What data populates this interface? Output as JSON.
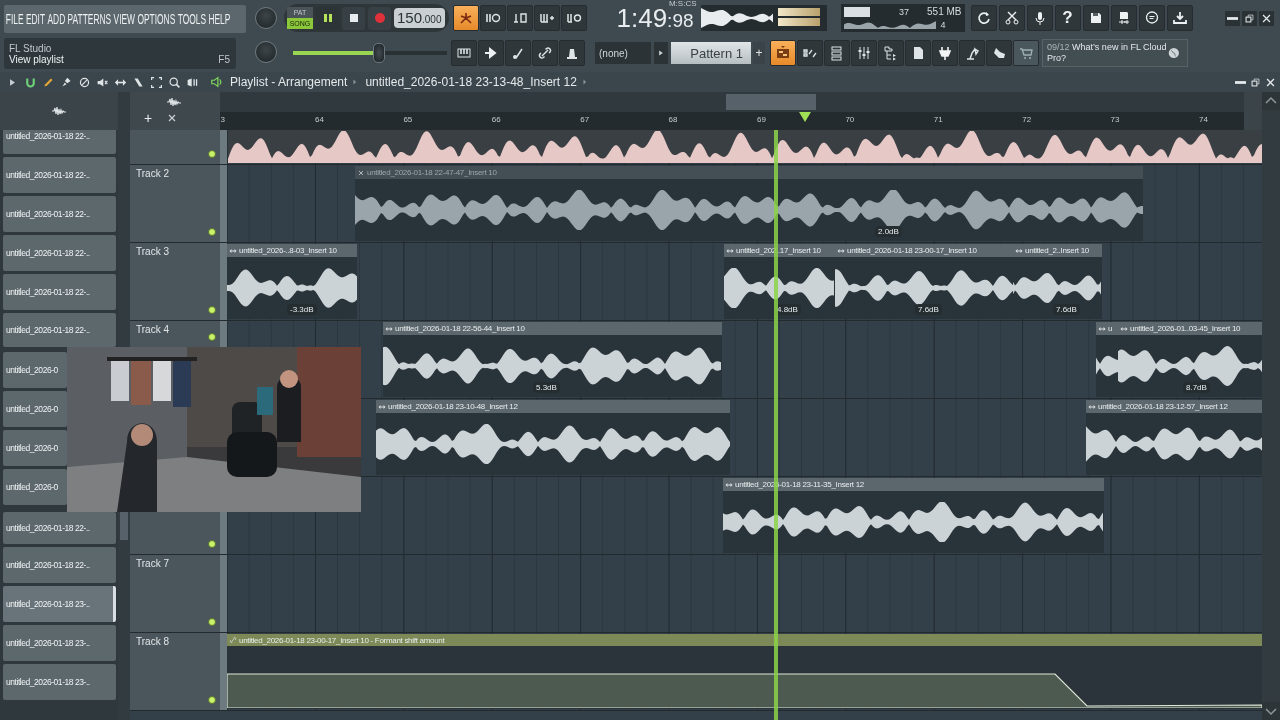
{
  "menu": [
    "FILE",
    "EDIT",
    "ADD",
    "PATTERNS",
    "VIEW",
    "OPTIONS",
    "TOOLS",
    "HELP"
  ],
  "hint": {
    "title": "FL Studio",
    "text": "View playlist",
    "shortcut": "F5"
  },
  "transport": {
    "modes": [
      {
        "label": "PAT",
        "selected": false
      },
      {
        "label": "SONG",
        "selected": true
      }
    ],
    "playing": true,
    "tempo": {
      "whole": "150",
      "fraction": ".000"
    },
    "master_pitch": {
      "level": 0.56
    }
  },
  "top_tools": [
    {
      "active": true
    },
    {
      "active": false
    },
    {
      "active": false
    },
    {
      "active": false
    },
    {
      "active": false
    }
  ],
  "time": {
    "main": "1:49",
    "fraction": ":98",
    "format": "M:S:CS"
  },
  "cpu": {
    "value": "37",
    "memory": "551 MB",
    "polyphony": "4"
  },
  "help_label": "?",
  "pattern_selector": {
    "none": "(none)",
    "pattern": "Pattern 1",
    "add": "+"
  },
  "view_buttons": [
    {
      "active": true
    },
    {
      "active": false
    },
    {
      "active": false
    },
    {
      "active": false
    },
    {
      "active": false
    },
    {
      "active": false
    },
    {
      "active": false
    },
    {
      "active": false
    },
    {
      "active": false
    },
    {
      "active": false
    }
  ],
  "news": {
    "counter": "09/12",
    "text": "What’s new in FL Cloud Pro?"
  },
  "playlist": {
    "title": "Playlist - Arrangement",
    "clip_source": "untitled_2026-01-18 23-13-48_Insert 12",
    "add_label": "+",
    "ruler": [
      "3",
      "64",
      "65",
      "66",
      "67",
      "68",
      "69",
      "70",
      "71",
      "72",
      "73",
      "74"
    ],
    "playhead": {
      "level": 0.571
    },
    "picker": [
      {
        "label": "untitled_2026-01-18 22-..",
        "selected": false
      },
      {
        "label": "untitled_2026-01-18 22-..",
        "selected": false
      },
      {
        "label": "untitled_2026-01-18 22-..",
        "selected": false
      },
      {
        "label": "untitled_2026-01-18 22-..",
        "selected": false
      },
      {
        "label": "untitled_2026-01-18 22-..",
        "selected": false
      },
      {
        "label": "untitled_2026-01-18 22-..",
        "selected": false
      },
      {
        "label": "untitled_2026-0",
        "selected": false
      },
      {
        "label": "untitled_2026-0",
        "selected": false
      },
      {
        "label": "untitled_2026-0",
        "selected": false
      },
      {
        "label": "untitled_2026-0",
        "selected": false
      },
      {
        "label": "untitled_2026-01-18 22-..",
        "selected": false
      },
      {
        "label": "untitled_2026-01-18 22-..",
        "selected": false
      },
      {
        "label": "untitled_2026-01-18 23-..",
        "selected": true
      },
      {
        "label": "untitled_2026-01-18 23-..",
        "selected": false
      },
      {
        "label": "untitled_2026-01-18 23-..",
        "selected": false
      }
    ],
    "tracks": [
      {
        "clips": [
          {
            "kind": "audio",
            "color": "#e6c8c6"
          }
        ]
      },
      {
        "name": "Track 2",
        "clips": [
          {
            "kind": "audio",
            "label": "untitled_2026-01-18 22-47-47_Insert 10",
            "gain": "2.0dB",
            "color": "#9aa5ab",
            "muted": true
          }
        ]
      },
      {
        "name": "Track 3",
        "clips": [
          {
            "kind": "audio",
            "label": "untitled_2026-..8-03_Insert 10",
            "gain": "-3.3dB",
            "color": "#ccd3d7",
            "muted": false
          },
          {
            "kind": "audio",
            "label": "untitled_202..17_Insert 10",
            "gain": "4.8dB",
            "color": "#ccd3d7",
            "muted": false
          },
          {
            "kind": "audio",
            "label": "untitled_2026-01-18 23-00-17_Insert 10",
            "gain": "7.6dB",
            "color": "#ccd3d7",
            "muted": false
          },
          {
            "kind": "audio",
            "label": "untitled_2..Insert 10",
            "gain": "7.6dB",
            "color": "#ccd3d7",
            "muted": false
          }
        ]
      },
      {
        "name": "Track 4",
        "clips": [
          {
            "kind": "audio",
            "label": "untitled_2026-01-18 22-56-44_Insert 10",
            "gain": "5.3dB",
            "color": "#ccd3d7",
            "muted": false
          },
          {
            "kind": "audio",
            "label": "u",
            "color": "#ccd3d7",
            "muted": false
          },
          {
            "kind": "audio",
            "label": "untitled_2026-01..03-45_Insert 10",
            "gain": "8.7dB",
            "color": "#ccd3d7",
            "muted": false
          }
        ]
      },
      {
        "clips": [
          {
            "kind": "audio",
            "label": "untitled_2026-01-18 23-10-48_Insert 12",
            "color": "#ccd3d7",
            "muted": false
          },
          {
            "kind": "audio",
            "label": "untitled_2026-01-18 23-12-57_Insert 12",
            "color": "#ccd3d7",
            "muted": false
          }
        ]
      },
      {
        "clips": [
          {
            "kind": "audio",
            "label": "untitled_2026-01-18 23-11-35_Insert 12",
            "color": "#ccd3d7",
            "muted": false
          }
        ]
      },
      {
        "name": "Track 7"
      },
      {
        "name": "Track 8",
        "clips": [
          {
            "kind": "automation",
            "label": "untitled_2026-01-18 23-00-17_Insert 10 - Formant shift amount",
            "color": "#7d8a57",
            "muted": false
          }
        ]
      }
    ]
  }
}
